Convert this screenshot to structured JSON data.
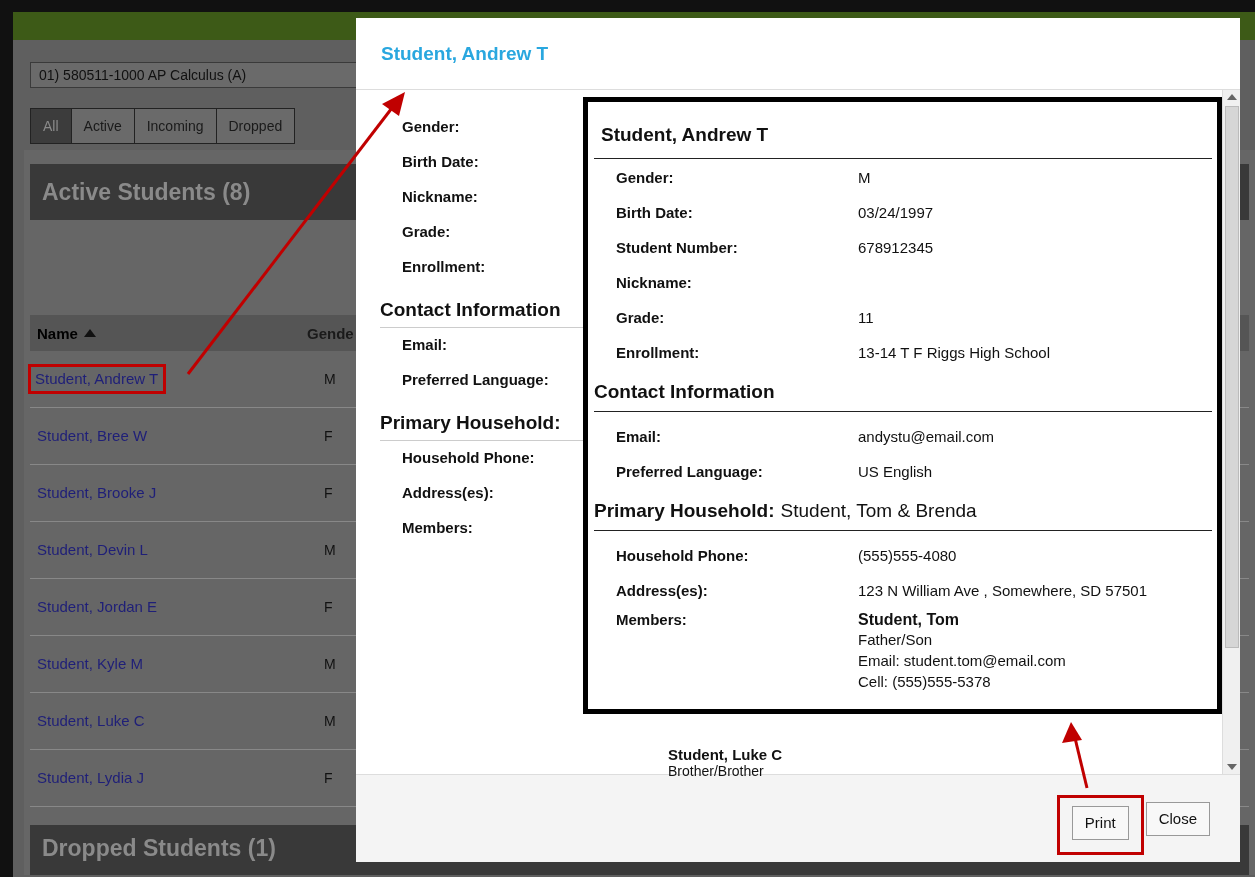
{
  "course_select": {
    "value": "01) 580511-1000 AP Calculus (A)"
  },
  "filter_tabs": [
    {
      "label": "All",
      "selected": true
    },
    {
      "label": "Active",
      "selected": false
    },
    {
      "label": "Incoming",
      "selected": false
    },
    {
      "label": "Dropped",
      "selected": false
    }
  ],
  "active_students": {
    "title": "Active Students (8)",
    "columns": [
      {
        "label": "Name",
        "sorted": true
      },
      {
        "label": "Gende",
        "sorted": false
      }
    ],
    "rows": [
      {
        "name": "Student, Andrew T",
        "gender": "M",
        "callout": true
      },
      {
        "name": "Student, Bree W",
        "gender": "F",
        "callout": false
      },
      {
        "name": "Student, Brooke J",
        "gender": "F",
        "callout": false
      },
      {
        "name": "Student, Devin L",
        "gender": "M",
        "callout": false
      },
      {
        "name": "Student, Jordan E",
        "gender": "F",
        "callout": false
      },
      {
        "name": "Student, Kyle M",
        "gender": "M",
        "callout": false
      },
      {
        "name": "Student, Luke C",
        "gender": "M",
        "callout": false
      },
      {
        "name": "Student, Lydia J",
        "gender": "F",
        "callout": false
      }
    ]
  },
  "dropped_students": {
    "title": "Dropped Students (1)"
  },
  "modal": {
    "title": "Student, Andrew T",
    "sections": [
      {
        "fields": [
          "Gender:",
          "Birth Date:",
          "Nickname:",
          "Grade:",
          "Enrollment:"
        ]
      },
      {
        "heading": "Contact Information",
        "fields": [
          "Email:",
          "Preferred Language:"
        ]
      },
      {
        "heading": "Primary Household:",
        "fields": [
          "Household Phone:",
          "Address(es):",
          "Members:"
        ]
      }
    ],
    "visible_member": {
      "name": "Student, Luke C",
      "relation": "Brother/Brother"
    },
    "buttons": [
      {
        "label": "Print",
        "callout": true
      },
      {
        "label": "Close",
        "callout": false
      }
    ]
  },
  "print_preview": {
    "title": "Student, Andrew T",
    "sections": [
      {
        "fields": [
          {
            "label": "Gender:",
            "value": "M"
          },
          {
            "label": "Birth Date:",
            "value": "03/24/1997"
          },
          {
            "label": "Student Number:",
            "value": "678912345"
          },
          {
            "label": "Nickname:"
          },
          {
            "label": "Grade:",
            "value": "11"
          },
          {
            "label": "Enrollment:",
            "value": "13-14 T F Riggs High School"
          }
        ]
      },
      {
        "heading": "Contact Information",
        "fields": [
          {
            "label": "Email:",
            "value": "andystu@email.com"
          },
          {
            "label": "Preferred Language:",
            "value": "US English"
          }
        ]
      },
      {
        "heading": "Primary Household:",
        "heading_value": "Student, Tom & Brenda",
        "fields": [
          {
            "label": "Household Phone:",
            "value": "(555)555-4080"
          },
          {
            "label": "Address(es):",
            "value": "123 N William Ave , Somewhere, SD 57501"
          }
        ]
      }
    ],
    "members_label": "Members:",
    "members": [
      {
        "name": "Student, Tom",
        "lines": [
          "Father/Son",
          "Email: student.tom@email.com",
          "Cell: (555)555-5378"
        ]
      }
    ]
  }
}
